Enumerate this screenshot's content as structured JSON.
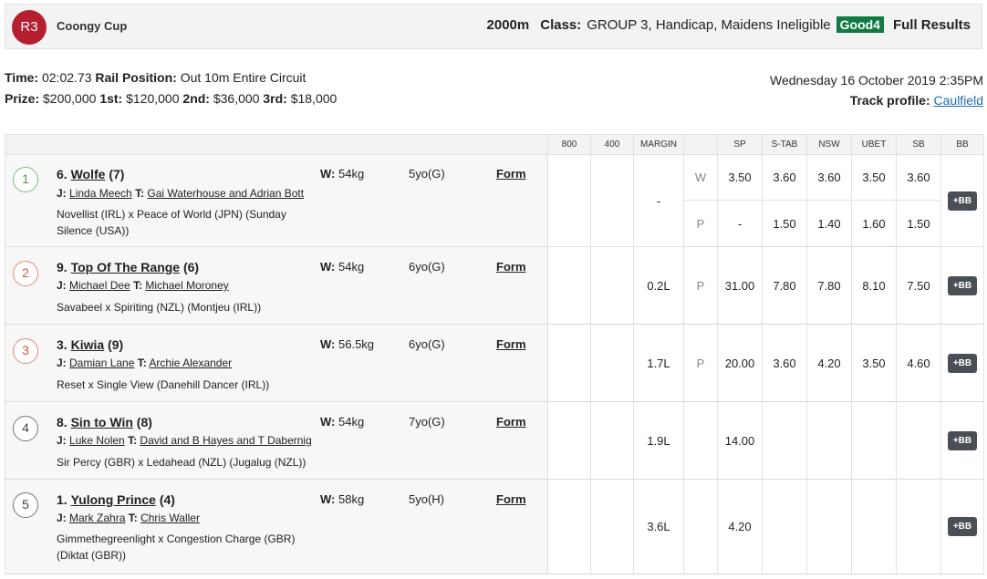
{
  "race": {
    "badge": "R3",
    "name": "Coongy Cup",
    "distance": "2000m",
    "class_label": "Class:",
    "class_value": "GROUP 3, Handicap, Maidens Ineligible",
    "track_condition": "Good4",
    "full_results": "Full Results"
  },
  "info": {
    "time_label": "Time:",
    "time_value": "02:02.73",
    "rail_label": "Rail Position:",
    "rail_value": "Out 10m Entire Circuit",
    "prize_label": "Prize:",
    "prize_value": "$200,000",
    "first_label": "1st:",
    "first_value": "$120,000",
    "second_label": "2nd:",
    "second_value": "$36,000",
    "third_label": "3rd:",
    "third_value": "$18,000",
    "date": "Wednesday 16 October 2019 2:35PM",
    "track_profile_label": "Track profile:",
    "track_profile_link": "Caulfield"
  },
  "columns": [
    "800",
    "400",
    "MARGIN",
    "",
    "SP",
    "S-TAB",
    "NSW",
    "UBET",
    "SB",
    "BB"
  ],
  "labels": {
    "j": "J:",
    "t": "T:",
    "w": "W:",
    "form": "Form",
    "bb": "+BB"
  },
  "runners": [
    {
      "pos": "1",
      "num": "6.",
      "name": "Wolfe",
      "barrier": "(7)",
      "jockey": "Linda Meech",
      "trainer": "Gai Waterhouse and Adrian Bott",
      "pedigree": "Novellist (IRL) x Peace of World (JPN) (Sunday Silence (USA))",
      "weight": "54kg",
      "age": "5yo(G)",
      "margin": "-",
      "win": {
        "tag": "W",
        "sp": "3.50",
        "stab": "3.60",
        "nsw": "3.60",
        "ubet": "3.50",
        "sb": "3.60"
      },
      "place": {
        "tag": "P",
        "sp": "-",
        "stab": "1.50",
        "nsw": "1.40",
        "ubet": "1.60",
        "sb": "1.50"
      }
    },
    {
      "pos": "2",
      "num": "9.",
      "name": "Top Of The Range",
      "barrier": "(6)",
      "jockey": "Michael Dee",
      "trainer": "Michael Moroney",
      "pedigree": "Savabeel x Spiriting (NZL) (Montjeu (IRL))",
      "weight": "54kg",
      "age": "6yo(G)",
      "margin": "0.2L",
      "place": {
        "tag": "P",
        "sp": "31.00",
        "stab": "7.80",
        "nsw": "7.80",
        "ubet": "8.10",
        "sb": "7.50"
      }
    },
    {
      "pos": "3",
      "num": "3.",
      "name": "Kiwia",
      "barrier": "(9)",
      "jockey": "Damian Lane",
      "trainer": "Archie Alexander",
      "pedigree": "Reset x Single View (Danehill Dancer (IRL))",
      "weight": "56.5kg",
      "age": "6yo(G)",
      "margin": "1.7L",
      "place": {
        "tag": "P",
        "sp": "20.00",
        "stab": "3.60",
        "nsw": "4.20",
        "ubet": "3.50",
        "sb": "4.60"
      }
    },
    {
      "pos": "4",
      "num": "8.",
      "name": "Sin to Win",
      "barrier": "(8)",
      "jockey": "Luke Nolen",
      "trainer": "David and B Hayes and T Dabernig",
      "pedigree": "Sir Percy (GBR) x Ledahead (NZL) (Jugalug (NZL))",
      "weight": "54kg",
      "age": "7yo(G)",
      "margin": "1.9L",
      "place": {
        "tag": "",
        "sp": "14.00",
        "stab": "",
        "nsw": "",
        "ubet": "",
        "sb": ""
      }
    },
    {
      "pos": "5",
      "num": "1.",
      "name": "Yulong Prince",
      "barrier": "(4)",
      "jockey": "Mark Zahra",
      "trainer": "Chris Waller",
      "pedigree": "Gimmethegreenlight x Congestion Charge (GBR) (Diktat (GBR))",
      "weight": "58kg",
      "age": "5yo(H)",
      "margin": "3.6L",
      "place": {
        "tag": "",
        "sp": "4.20",
        "stab": "",
        "nsw": "",
        "ubet": "",
        "sb": ""
      }
    }
  ]
}
